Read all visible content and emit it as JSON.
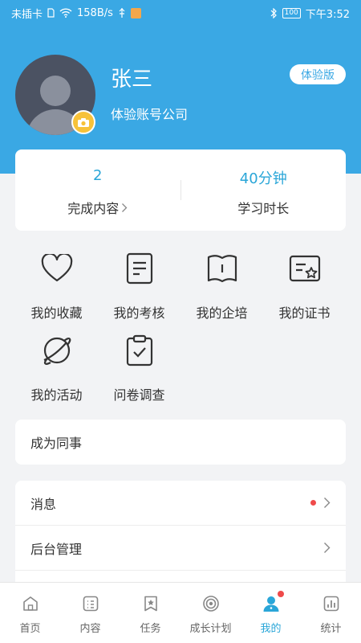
{
  "status_bar": {
    "carrier": "未插卡",
    "speed": "158B/s",
    "battery": "100",
    "time": "下午3:52"
  },
  "profile": {
    "name": "张三",
    "company": "体验账号公司",
    "badge": "体验版"
  },
  "stats": [
    {
      "value": "2",
      "label": "完成内容"
    },
    {
      "value": "40分钟",
      "label": "学习时长"
    }
  ],
  "grid": [
    {
      "label": "我的收藏",
      "icon": "heart-icon"
    },
    {
      "label": "我的考核",
      "icon": "document-icon"
    },
    {
      "label": "我的企培",
      "icon": "book-icon"
    },
    {
      "label": "我的证书",
      "icon": "certificate-icon"
    },
    {
      "label": "我的活动",
      "icon": "planet-icon"
    },
    {
      "label": "问卷调查",
      "icon": "clipboard-check-icon"
    }
  ],
  "colleague": {
    "label": "成为同事"
  },
  "menu": [
    {
      "label": "消息",
      "has_dot": true
    },
    {
      "label": "后台管理",
      "has_dot": false
    }
  ],
  "tabs": [
    {
      "label": "首页",
      "icon": "home-icon"
    },
    {
      "label": "内容",
      "icon": "content-icon"
    },
    {
      "label": "任务",
      "icon": "task-icon"
    },
    {
      "label": "成长计划",
      "icon": "target-icon"
    },
    {
      "label": "我的",
      "icon": "user-icon",
      "active": true
    },
    {
      "label": "统计",
      "icon": "stats-icon"
    }
  ],
  "colors": {
    "primary": "#3aa8e4",
    "accent_text": "#2aa6d8",
    "badge_dot": "#ef4a4a",
    "camera": "#f7c23a"
  }
}
